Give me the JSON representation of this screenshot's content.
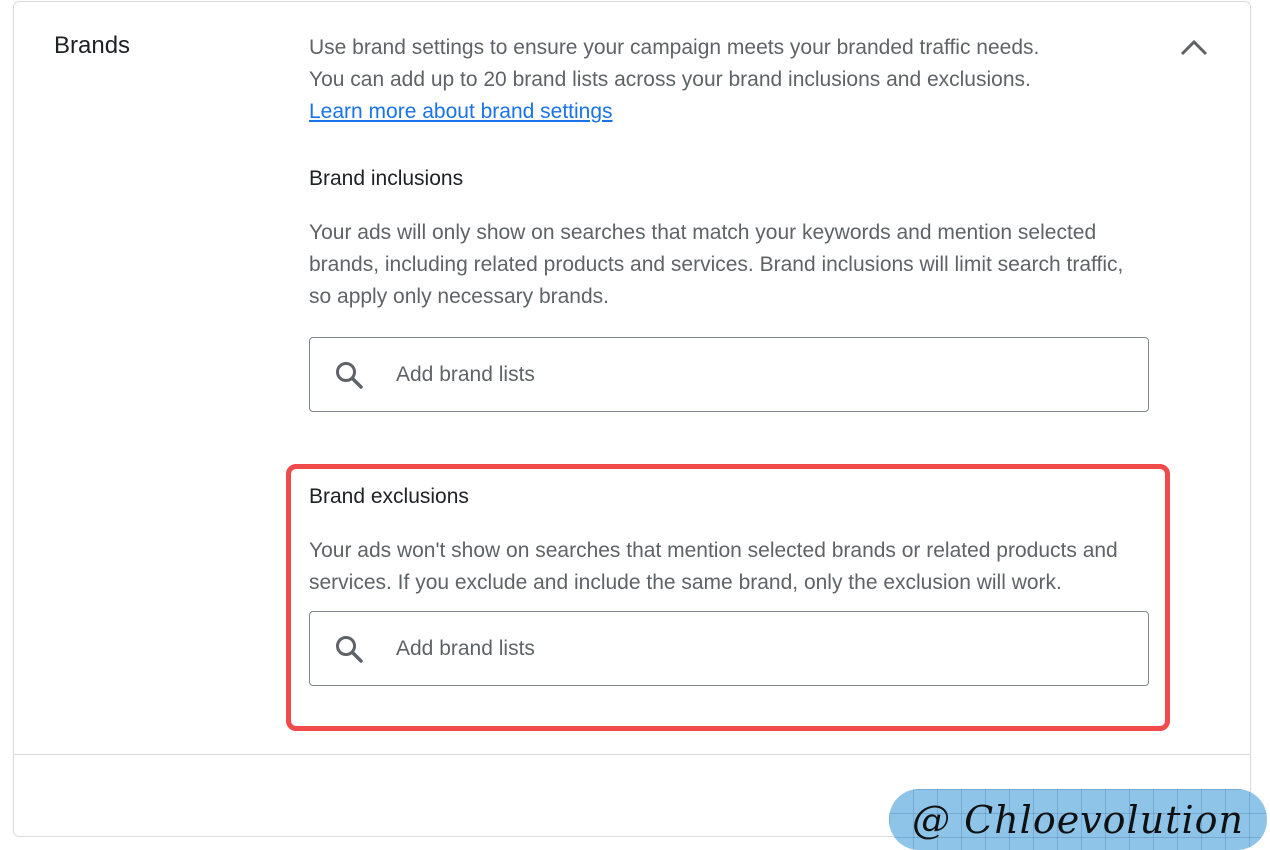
{
  "section": {
    "title": "Brands",
    "intro_line1": "Use brand settings to ensure your campaign meets your branded traffic needs.",
    "intro_line2": "You can add up to 20 brand lists across your brand inclusions and exclusions.",
    "learn_more": "Learn more about brand settings"
  },
  "inclusions": {
    "heading": "Brand inclusions",
    "description": "Your ads will only show on searches that match your keywords and mention selected brands, including related products and services. Brand inclusions will limit search traffic, so apply only necessary brands.",
    "placeholder": "Add brand lists"
  },
  "exclusions": {
    "heading": "Brand exclusions",
    "description": "Your ads won't show on searches that mention selected brands or related products and services. If you exclude and include the same brand, only the exclusion will work.",
    "placeholder": "Add brand lists"
  },
  "watermark": {
    "text": "@ Chloevolution"
  },
  "icons": {
    "collapse": "chevron-up-icon",
    "search": "search-icon"
  },
  "colors": {
    "link": "#1a73e8",
    "highlight": "#f04a4a",
    "watermark_bg": "#8ec4e8"
  }
}
